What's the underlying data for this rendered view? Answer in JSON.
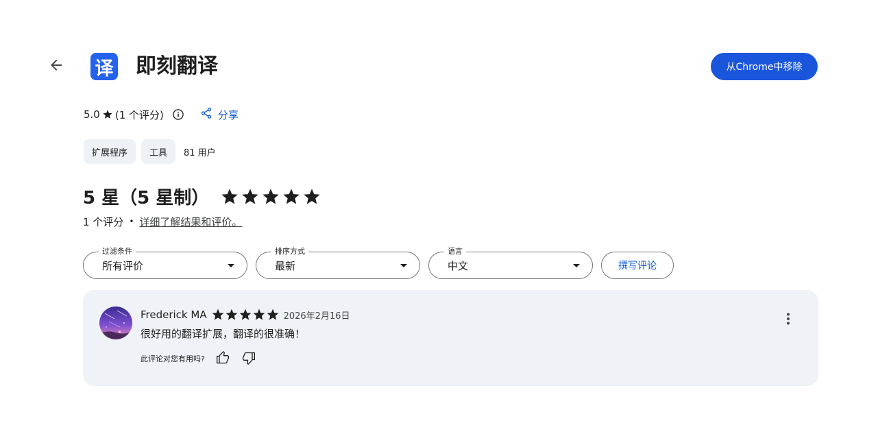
{
  "app": {
    "icon_char": "译",
    "title": "即刻翻译",
    "remove_label": "从Chrome中移除"
  },
  "rating": {
    "score": "5.0",
    "count_text": "(1 个评分)",
    "share_label": "分享"
  },
  "chips": [
    "扩展程序",
    "工具"
  ],
  "users": "81 用户",
  "summary": {
    "title": "5 星（5 星制）",
    "stars": 5,
    "count": "1 个评分",
    "link": "详细了解结果和评价。"
  },
  "filters": [
    {
      "label": "过滤条件",
      "value": "所有评价"
    },
    {
      "label": "排序方式",
      "value": "最新"
    },
    {
      "label": "语言",
      "value": "中文"
    }
  ],
  "write_review_label": "撰写评论",
  "review": {
    "author": "Frederick MA",
    "stars": 5,
    "date": "2026年2月16日",
    "text": "很好用的翻译扩展，翻译的很准确！",
    "helpful_prompt": "此评论对您有用吗?"
  },
  "colors": {
    "primary": "#1a56db",
    "link": "#0b57d0",
    "card_bg": "#eff2f7",
    "chip_bg": "#eef1f6"
  }
}
